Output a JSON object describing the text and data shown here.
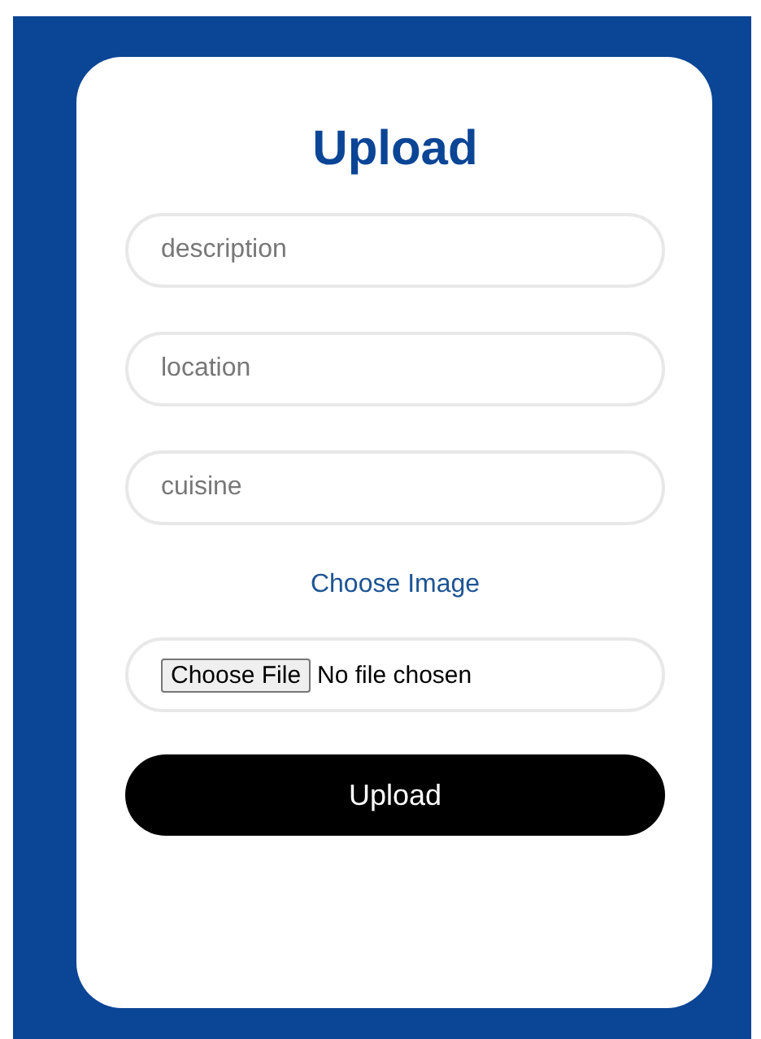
{
  "title": "Upload",
  "fields": [
    {
      "placeholder": "description"
    },
    {
      "placeholder": "location"
    },
    {
      "placeholder": "cuisine"
    }
  ],
  "image_label": "Choose Image",
  "file_input": {
    "button": "Choose File",
    "status": "No file chosen"
  },
  "submit": "Upload"
}
